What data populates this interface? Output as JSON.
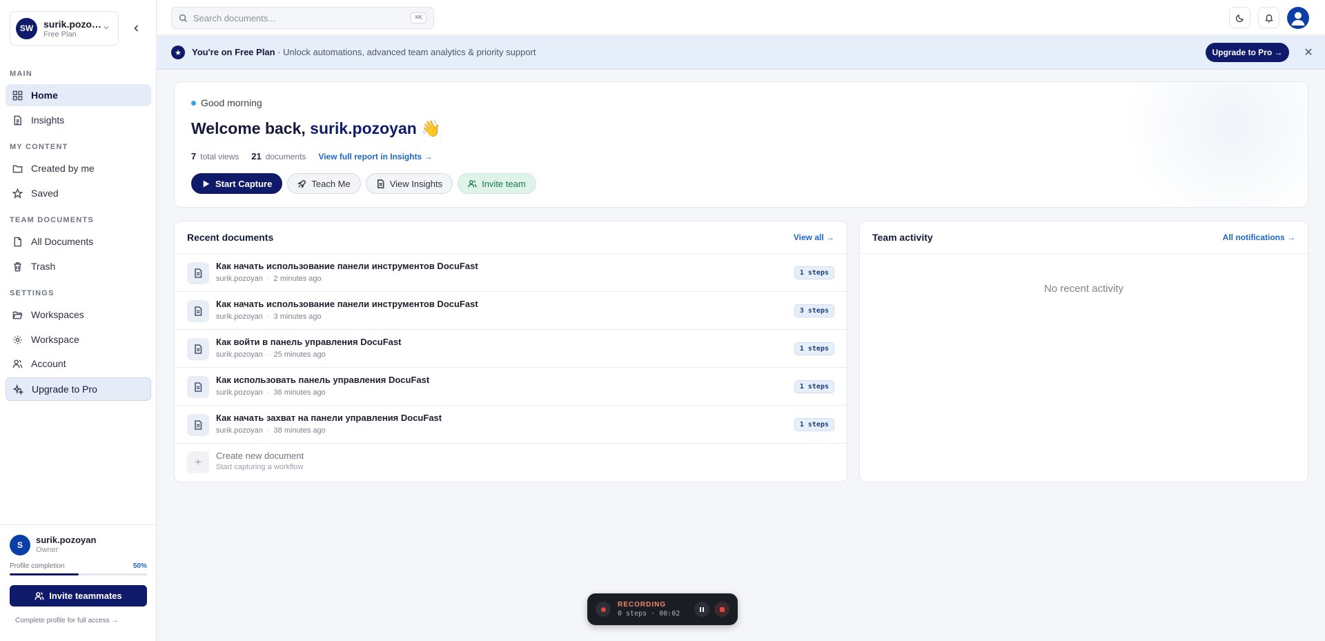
{
  "sidebar": {
    "workspace": {
      "initials": "SW",
      "name": "surik.pozoy…",
      "plan": "Free Plan"
    },
    "sections": {
      "main": "MAIN",
      "my_content": "MY CONTENT",
      "team_documents": "TEAM DOCUMENTS",
      "settings": "SETTINGS"
    },
    "items": {
      "home": "Home",
      "insights": "Insights",
      "created_by_me": "Created by me",
      "saved": "Saved",
      "all_documents": "All Documents",
      "trash": "Trash",
      "workspaces": "Workspaces",
      "workspace": "Workspace",
      "account": "Account",
      "upgrade": "Upgrade to Pro"
    },
    "profile": {
      "initial": "S",
      "name": "surik.pozoyan",
      "role": "Owner",
      "completion_label": "Profile completion",
      "completion_text": "50%",
      "completion_value": 0.5,
      "invite_label": "Invite teammates",
      "complete_link": "Complete profile for full access →"
    }
  },
  "topbar": {
    "search_placeholder": "Search documents...",
    "shortcut": "⌘K"
  },
  "banner": {
    "strong": "You're on Free Plan",
    "text": " · Unlock automations, advanced team analytics & priority support",
    "button": "Upgrade to Pro →"
  },
  "welcome": {
    "greeting": "Good morning",
    "title_prefix": "Welcome back, ",
    "username": "surik.pozoyan",
    "emoji": "👋",
    "views_count": "7",
    "views_label": "total views",
    "docs_count": "21",
    "docs_label": "documents",
    "report_link": "View full report in Insights →",
    "actions": {
      "start_capture": "Start Capture",
      "teach_me": "Teach Me",
      "view_insights": "View Insights",
      "invite_team": "Invite team"
    }
  },
  "recent_docs": {
    "title": "Recent documents",
    "view_all": "View all →",
    "rows": [
      {
        "title": "Как начать использование панели инструментов DocuFast",
        "author": "surik.pozoyan",
        "time": "2 minutes ago",
        "steps": "1 steps"
      },
      {
        "title": "Как начать использование панели инструментов DocuFast",
        "author": "surik.pozoyan",
        "time": "3 minutes ago",
        "steps": "3 steps"
      },
      {
        "title": "Как войти в панель управления DocuFast",
        "author": "surik.pozoyan",
        "time": "25 minutes ago",
        "steps": "1 steps"
      },
      {
        "title": "Как использовать панель управления DocuFast",
        "author": "surik.pozoyan",
        "time": "36 minutes ago",
        "steps": "1 steps"
      },
      {
        "title": "Как начать захват на панели управления DocuFast",
        "author": "surik.pozoyan",
        "time": "38 minutes ago",
        "steps": "1 steps"
      }
    ],
    "create": {
      "title": "Create new document",
      "subtitle": "Start capturing a workflow"
    }
  },
  "team_activity": {
    "title": "Team activity",
    "link": "All notifications →",
    "empty": "No recent activity"
  },
  "recording": {
    "label": "RECORDING",
    "info": "0 steps · 00:02"
  },
  "colors": {
    "brand_navy": "#0f1a6b",
    "link_blue": "#1e66c9",
    "banner_bg": "#e6eef9",
    "invite_green": "#1c7a4d",
    "record_red": "#e0443c"
  },
  "icons": {
    "home": "grid-icon",
    "insights": "document-icon",
    "created_by_me": "folder-icon",
    "saved": "star-icon",
    "all_documents": "file-icon",
    "trash": "trash-icon",
    "workspaces": "folder-open-icon",
    "workspace": "gear-icon",
    "account": "users-icon",
    "upgrade": "sparkle-icon"
  }
}
